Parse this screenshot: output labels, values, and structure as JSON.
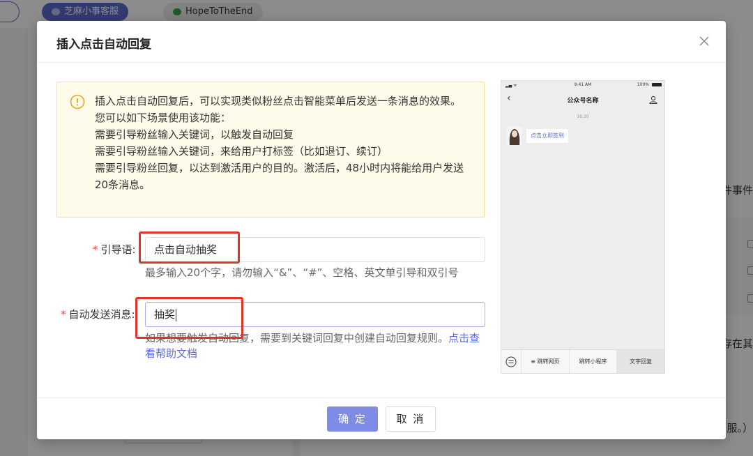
{
  "background": {
    "tabs": [
      {
        "label": "芝麻小事客服"
      },
      {
        "label": "HopeToTheEnd"
      }
    ],
    "right_fragments": [
      "件事件",
      "存在其",
      "服。）"
    ]
  },
  "modal": {
    "title": "插入点击自动回复",
    "notice_lines": [
      "插入点击自动回复后，可以实现类似粉丝点击智能菜单后发送一条消息的效果。",
      "您可以如下场景使用该功能：",
      "需要引导粉丝输入关键词，以触发自动回复",
      "需要引导粉丝输入关键词，来给用户打标签（比如退订、续订）",
      "需要引导粉丝回复，以达到激活用户的目的。激活后，48小时内将能给用户发送20条消息。"
    ],
    "fields": {
      "guide": {
        "required_mark": "*",
        "label": "引导语:",
        "value": "点击自动抽奖",
        "hint": "最多输入20个字，请勿输入“&”、“#”、空格、英文单引导和双引号"
      },
      "auto_message": {
        "required_mark": "*",
        "label": "自动发送消息:",
        "value": "抽奖",
        "hint_prefix": "如果想要触发自动回复，需要到关键词回复中创建自动回复规则。",
        "hint_link": "点击查看帮助文档"
      }
    },
    "preview": {
      "status_time": "9:41 AM",
      "status_battery": "100%",
      "account_name": "公众号名称",
      "message_time": "16:20",
      "bubble_text": "点击立即签到",
      "menu": [
        "≡ 跳转网页",
        "跳转小程序",
        "文字回复"
      ]
    },
    "buttons": {
      "confirm": "确 定",
      "cancel": "取 消"
    }
  },
  "colors": {
    "primary": "#7f8ce6",
    "link": "#5b6ad0",
    "annotation": "#e0342a",
    "required": "#e64340",
    "notice_bg": "#fefbea"
  }
}
